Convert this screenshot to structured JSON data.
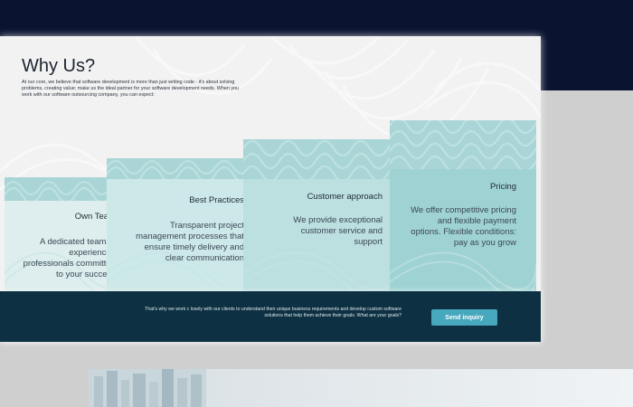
{
  "why_us": {
    "title": "Why Us?",
    "intro": "At our core, we believe that software development is more than just writing code - it's about solving problems, creating value; make us the ideal partner for your software development needs. When you work with our software outsourcing company, you can expect:"
  },
  "cards": [
    {
      "title": "Own Team",
      "description": "A dedicated team of experienced professionals committed to your success"
    },
    {
      "title": "Best Practices",
      "description": "Transparent project management processes that ensure timely delivery and clear communication"
    },
    {
      "title": "Customer approach",
      "description": "We provide exceptional customer service and support"
    },
    {
      "title": "Pricing",
      "description": "We offer competitive pricing and flexible payment options. Flexible conditions: pay as you grow"
    }
  ],
  "cta": {
    "text": "That's why we work c losely with our clients to understand their unique business requirements and develop custom software solutions that help them achieve their goals. What are your goals?",
    "button_label": "Send inquiry"
  },
  "colors": {
    "top_band": "#0a1330",
    "cta_bar": "#0d3142",
    "button": "#46a7bd",
    "card_pattern": "#a9d5d6"
  }
}
